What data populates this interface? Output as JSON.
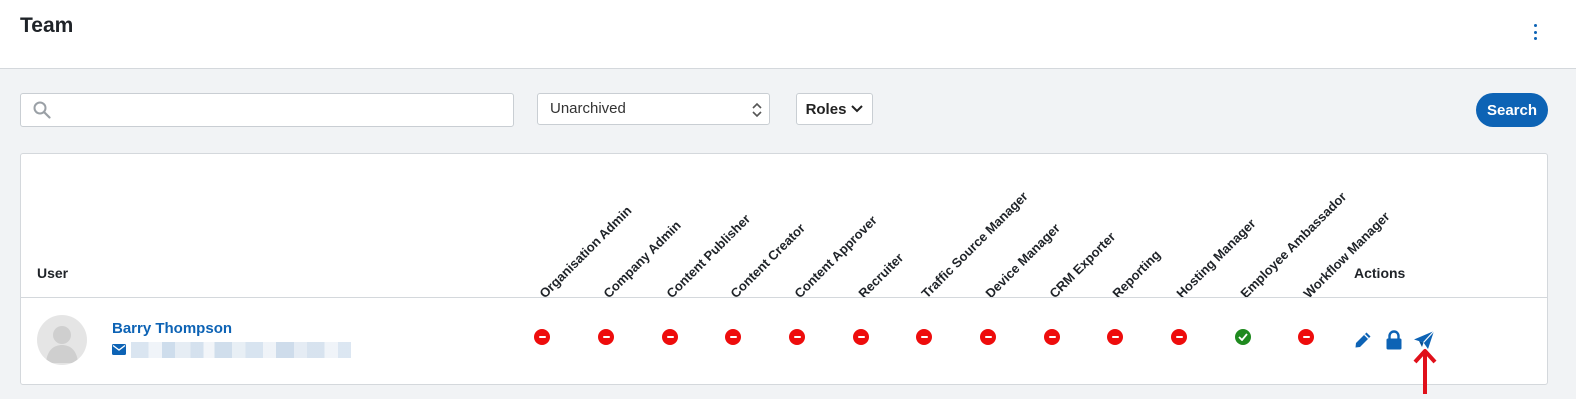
{
  "header": {
    "title": "Team",
    "menu_icon": "kebab-menu-icon"
  },
  "filters": {
    "search_value": "",
    "search_placeholder": "",
    "archive_selected": "Unarchived",
    "roles_label": "Roles",
    "search_button": "Search"
  },
  "table": {
    "user_header": "User",
    "actions_header": "Actions",
    "roles": [
      "Organisation Admin",
      "Company Admin",
      "Content Publisher",
      "Content Creator",
      "Content Approver",
      "Recruiter",
      "Traffic Source Manager",
      "Device Manager",
      "CRM Exporter",
      "Reporting",
      "Hosting Manager",
      "Employee Ambassador",
      "Workflow Manager"
    ],
    "rows": [
      {
        "name": "Barry Thompson",
        "email": "",
        "role_status": [
          false,
          false,
          false,
          false,
          false,
          false,
          false,
          false,
          false,
          false,
          false,
          true,
          false
        ]
      }
    ]
  },
  "colors": {
    "accent": "#0d63b5",
    "status_no": "#ee0c0c",
    "status_yes": "#1f8a1f",
    "pointer_arrow": "#e0101a"
  }
}
